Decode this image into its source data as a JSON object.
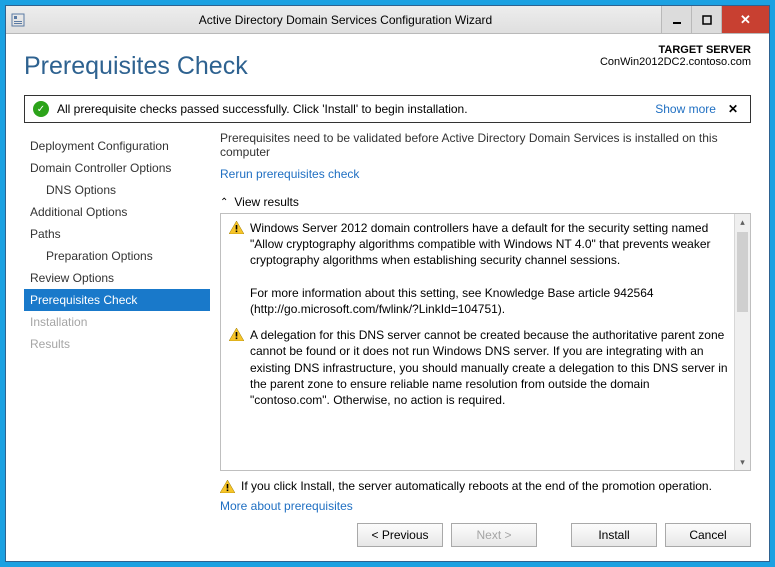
{
  "window": {
    "title": "Active Directory Domain Services Configuration Wizard"
  },
  "header": {
    "page_title": "Prerequisites Check",
    "target_label": "TARGET SERVER",
    "target_value": "ConWin2012DC2.contoso.com"
  },
  "banner": {
    "text": "All prerequisite checks passed successfully. Click 'Install' to begin installation.",
    "show_more": "Show more"
  },
  "nav": [
    {
      "label": "Deployment Configuration"
    },
    {
      "label": "Domain Controller Options"
    },
    {
      "label": "DNS Options",
      "sub": true
    },
    {
      "label": "Additional Options"
    },
    {
      "label": "Paths"
    },
    {
      "label": "Preparation Options",
      "sub": true
    },
    {
      "label": "Review Options"
    },
    {
      "label": "Prerequisites Check",
      "active": true
    },
    {
      "label": "Installation",
      "disabled": true
    },
    {
      "label": "Results",
      "disabled": true
    }
  ],
  "content": {
    "intro": "Prerequisites need to be validated before Active Directory Domain Services is installed on this computer",
    "rerun": "Rerun prerequisites check",
    "view_results": "View results",
    "messages": [
      "Windows Server 2012 domain controllers have a default for the security setting named \"Allow cryptography algorithms compatible with Windows NT 4.0\" that prevents weaker cryptography algorithms when establishing security channel sessions.\n\nFor more information about this setting, see Knowledge Base article 942564 (http://go.microsoft.com/fwlink/?LinkId=104751).",
      "A delegation for this DNS server cannot be created because the authoritative parent zone cannot be found or it does not run Windows DNS server. If you are integrating with an existing DNS infrastructure, you should manually create a delegation to this DNS server in the parent zone to ensure reliable name resolution from outside the domain \"contoso.com\". Otherwise, no action is required."
    ],
    "footnote": "If you click Install, the server automatically reboots at the end of the promotion operation.",
    "more_link": "More about prerequisites"
  },
  "buttons": {
    "previous": "< Previous",
    "next": "Next >",
    "install": "Install",
    "cancel": "Cancel"
  }
}
